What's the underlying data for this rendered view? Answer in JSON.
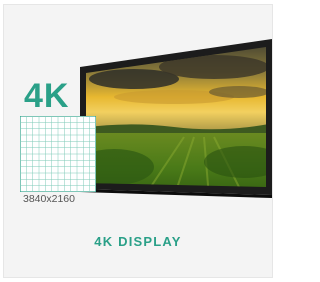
{
  "badge": {
    "label": "4K",
    "resolution": "3840x2160",
    "accent_color": "#2aa088"
  },
  "product": {
    "caption": "4K DISPLAY",
    "image_icon": "display-monitor-icon",
    "screen_scene": "landscape sunset over green fields"
  }
}
